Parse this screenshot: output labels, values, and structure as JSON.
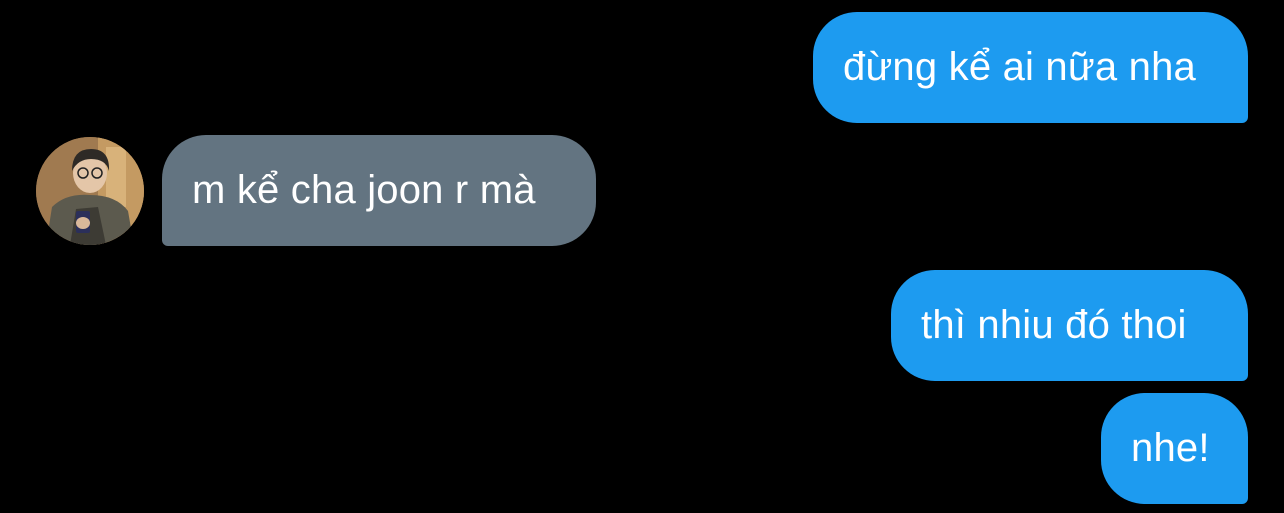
{
  "conversation": {
    "messages": [
      {
        "direction": "outgoing",
        "text": "đừng kể ai nữa nha"
      },
      {
        "direction": "incoming",
        "text": "m kể cha joon r mà"
      },
      {
        "direction": "outgoing",
        "text": "thì nhiu đó thoi"
      },
      {
        "direction": "outgoing",
        "text": "nhe!"
      }
    ],
    "incoming_avatar": "user-avatar-photo"
  },
  "colors": {
    "background": "#000000",
    "outgoing_bubble": "#1d9bf0",
    "incoming_bubble": "#637481",
    "text": "#ffffff"
  }
}
